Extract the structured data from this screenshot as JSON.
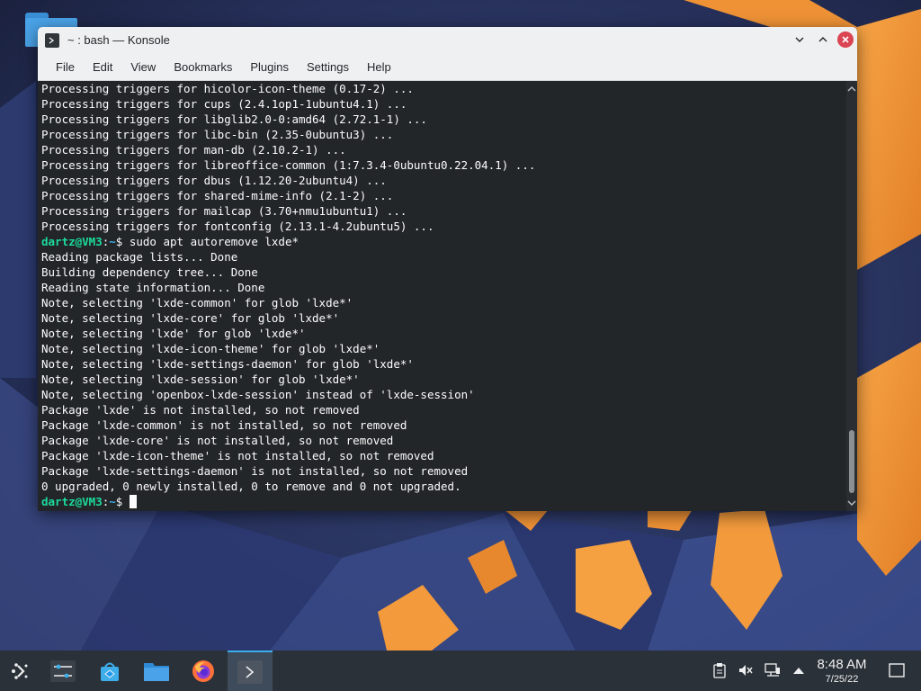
{
  "window": {
    "title": "~ : bash — Konsole",
    "icon": "terminal-icon"
  },
  "menu": [
    "File",
    "Edit",
    "View",
    "Bookmarks",
    "Plugins",
    "Settings",
    "Help"
  ],
  "terminal": {
    "lines": [
      {
        "text": "Processing triggers for hicolor-icon-theme (0.17-2) ..."
      },
      {
        "text": "Processing triggers for cups (2.4.1op1-1ubuntu4.1) ..."
      },
      {
        "text": "Processing triggers for libglib2.0-0:amd64 (2.72.1-1) ..."
      },
      {
        "text": "Processing triggers for libc-bin (2.35-0ubuntu3) ..."
      },
      {
        "text": "Processing triggers for man-db (2.10.2-1) ..."
      },
      {
        "text": "Processing triggers for libreoffice-common (1:7.3.4-0ubuntu0.22.04.1) ..."
      },
      {
        "text": "Processing triggers for dbus (1.12.20-2ubuntu4) ..."
      },
      {
        "text": "Processing triggers for shared-mime-info (2.1-2) ..."
      },
      {
        "text": "Processing triggers for mailcap (3.70+nmu1ubuntu1) ..."
      },
      {
        "text": "Processing triggers for fontconfig (2.13.1-4.2ubuntu5) ..."
      },
      {
        "prompt": {
          "user": "dartz@VM3",
          "path": "~",
          "sym": "$ "
        },
        "text": "sudo apt autoremove lxde*"
      },
      {
        "text": "Reading package lists... Done"
      },
      {
        "text": "Building dependency tree... Done"
      },
      {
        "text": "Reading state information... Done"
      },
      {
        "text": "Note, selecting 'lxde-common' for glob 'lxde*'"
      },
      {
        "text": "Note, selecting 'lxde-core' for glob 'lxde*'"
      },
      {
        "text": "Note, selecting 'lxde' for glob 'lxde*'"
      },
      {
        "text": "Note, selecting 'lxde-icon-theme' for glob 'lxde*'"
      },
      {
        "text": "Note, selecting 'lxde-settings-daemon' for glob 'lxde*'"
      },
      {
        "text": "Note, selecting 'lxde-session' for glob 'lxde*'"
      },
      {
        "text": "Note, selecting 'openbox-lxde-session' instead of 'lxde-session'"
      },
      {
        "text": "Package 'lxde' is not installed, so not removed"
      },
      {
        "text": "Package 'lxde-common' is not installed, so not removed"
      },
      {
        "text": "Package 'lxde-core' is not installed, so not removed"
      },
      {
        "text": "Package 'lxde-icon-theme' is not installed, so not removed"
      },
      {
        "text": "Package 'lxde-settings-daemon' is not installed, so not removed"
      },
      {
        "text": "0 upgraded, 0 newly installed, 0 to remove and 0 not upgraded."
      },
      {
        "prompt": {
          "user": "dartz@VM3",
          "path": "~",
          "sym": "$ "
        },
        "text": "",
        "cursor": true
      }
    ],
    "scroll_position": 1.0
  },
  "taskbar": {
    "launchers": [
      "application-launcher-icon",
      "system-settings-icon",
      "discover-store-icon",
      "file-manager-icon",
      "firefox-icon",
      "konsole-icon"
    ],
    "active": "konsole-icon",
    "tray": [
      "clipboard-icon",
      "volume-muted-icon",
      "network-icon",
      "expand-tray-icon"
    ],
    "clock": {
      "time": "8:48 AM",
      "date": "7/25/22"
    },
    "show_desktop": "show-desktop-icon"
  },
  "colors": {
    "prompt_user": "#1cdc9a",
    "prompt_path": "#3daee9",
    "terminal_bg": "#232629",
    "close_button": "#da4453",
    "wallpaper_orange": "#f39c3c"
  }
}
